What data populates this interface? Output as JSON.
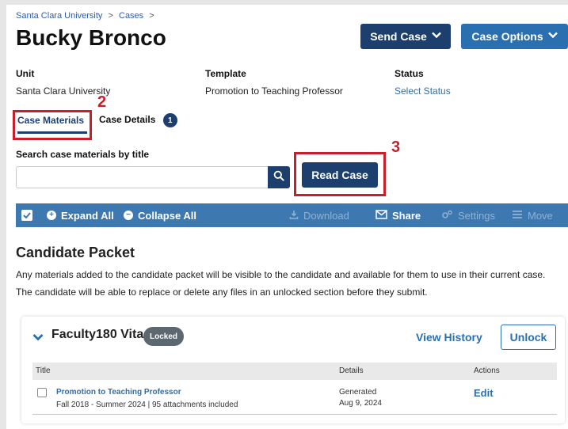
{
  "breadcrumb": {
    "items": [
      "Santa Clara University",
      "Cases"
    ],
    "separator": ">"
  },
  "page": {
    "title": "Bucky Bronco"
  },
  "header_buttons": {
    "send_case": "Send Case",
    "case_options": "Case Options"
  },
  "meta": {
    "unit_label": "Unit",
    "unit_value": "Santa Clara University",
    "template_label": "Template",
    "template_value": "Promotion to Teaching Professor",
    "status_label": "Status",
    "status_value": "Select Status"
  },
  "tabs": [
    {
      "label": "Case Materials",
      "active": true
    },
    {
      "label": "Case Details",
      "badge": "1",
      "active": false
    }
  ],
  "annotations": [
    "2",
    "3"
  ],
  "search": {
    "label": "Search case materials by title",
    "value": "",
    "placeholder": ""
  },
  "read_case_button": "Read Case",
  "toolbar": {
    "expand_all": "Expand All",
    "collapse_all": "Collapse All",
    "download": "Download",
    "share": "Share",
    "settings": "Settings",
    "move": "Move"
  },
  "candidate_packet": {
    "title": "Candidate Packet",
    "description": "Any materials added to the candidate packet will be visible to the candidate and available for them to use in their current case. The candidate will be able to replace or delete any files in an unlocked section before they submit."
  },
  "section_card": {
    "title": "Faculty180 Vita",
    "lock_badge": "Locked",
    "view_history": "View History",
    "unlock": "Unlock",
    "columns": [
      "Title",
      "Details",
      "Actions"
    ],
    "rows": [
      {
        "title": "Promotion to Teaching Professor",
        "subtitle": "Fall 2018 - Summer 2024 | 95 attachments included",
        "details_line1": "Generated",
        "details_line2": "Aug 9, 2024",
        "action": "Edit"
      }
    ]
  },
  "colors": {
    "navy": "#1c3f6e",
    "blue": "#2a6fb0",
    "toolbar_blue": "#3d78b0",
    "annotation_red": "#c8202b",
    "locked_gray": "#5c6770"
  }
}
